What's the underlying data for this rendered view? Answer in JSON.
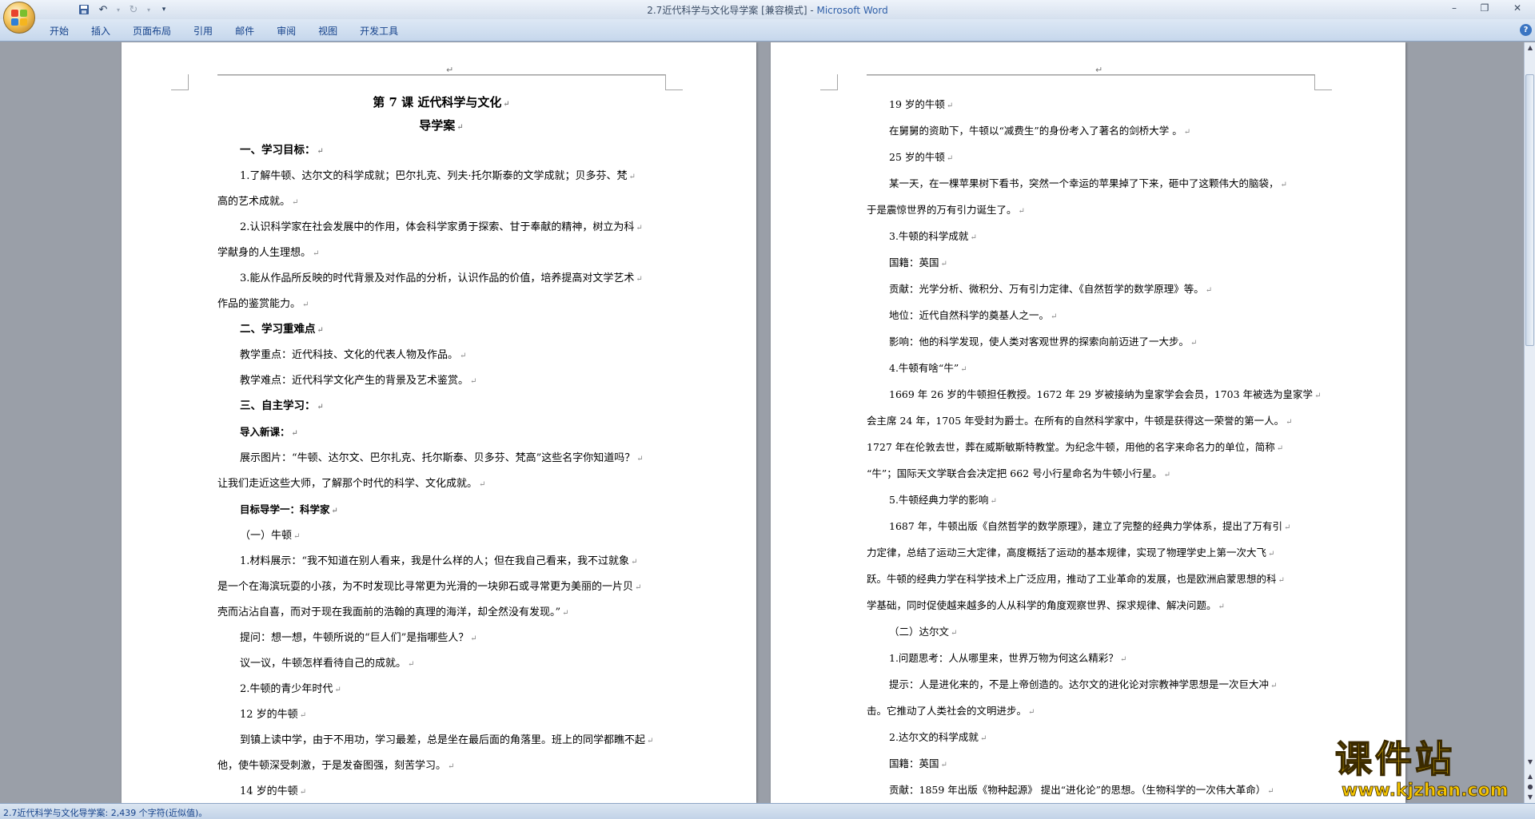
{
  "window": {
    "title": "2.7近代科学与文化导学案 [兼容模式]",
    "app_name": "Microsoft Word",
    "title_separator": " - "
  },
  "quick_access": {
    "icons": [
      "save-icon",
      "undo-icon",
      "redo-icon",
      "customize-icon"
    ]
  },
  "ribbon": {
    "tabs": [
      "开始",
      "插入",
      "页面布局",
      "引用",
      "邮件",
      "审阅",
      "视图",
      "开发工具"
    ]
  },
  "document": {
    "left_page": [
      {
        "text": "第 7 课  近代科学与文化",
        "style": "title"
      },
      {
        "text": "导学案",
        "style": "title"
      },
      {
        "text": "一、学习目标：",
        "style": "heading"
      },
      {
        "text": "1.了解牛顿、达尔文的科学成就；巴尔扎克、列夫·托尔斯泰的文学成就；贝多芬、梵",
        "style": "ind"
      },
      {
        "text": "高的艺术成就。",
        "style": "plain"
      },
      {
        "text": "2.认识科学家在社会发展中的作用，体会科学家勇于探索、甘于奉献的精神，树立为科",
        "style": "ind"
      },
      {
        "text": "学献身的人生理想。",
        "style": "plain"
      },
      {
        "text": "3.能从作品所反映的时代背景及对作品的分析，认识作品的价值，培养提高对文学艺术",
        "style": "ind"
      },
      {
        "text": "作品的鉴赏能力。",
        "style": "plain"
      },
      {
        "text": "二、学习重难点",
        "style": "heading"
      },
      {
        "text": "教学重点：近代科技、文化的代表人物及作品。",
        "style": "ind"
      },
      {
        "text": "教学难点：近代科学文化产生的背景及艺术鉴赏。",
        "style": "ind"
      },
      {
        "text": "三、自主学习：",
        "style": "heading"
      },
      {
        "text": "导入新课：",
        "style": "heading-small"
      },
      {
        "text": "展示图片：“牛顿、达尔文、巴尔扎克、托尔斯泰、贝多芬、梵高”这些名字你知道吗？",
        "style": "ind"
      },
      {
        "text": "让我们走近这些大师，了解那个时代的科学、文化成就。",
        "style": "plain"
      },
      {
        "text": "目标导学一：科学家",
        "style": "heading-small"
      },
      {
        "text": "（一）牛顿",
        "style": "ind"
      },
      {
        "text": "1.材料展示：“我不知道在别人看来，我是什么样的人；但在我自己看来，我不过就象",
        "style": "ind"
      },
      {
        "text": "是一个在海滨玩耍的小孩，为不时发现比寻常更为光滑的一块卵石或寻常更为美丽的一片贝",
        "style": "plain"
      },
      {
        "text": "壳而沾沾自喜，而对于现在我面前的浩翰的真理的海洋，却全然没有发现。”",
        "style": "plain"
      },
      {
        "text": "提问：想一想，牛顿所说的“巨人们”是指哪些人？",
        "style": "ind"
      },
      {
        "text": "议一议，牛顿怎样看待自己的成就。",
        "style": "ind"
      },
      {
        "text": "2.牛顿的青少年时代",
        "style": "ind"
      },
      {
        "text": "12 岁的牛顿",
        "style": "ind"
      },
      {
        "text": "到镇上读中学，由于不用功，学习最差，总是坐在最后面的角落里。班上的同学都瞧不起",
        "style": "ind"
      },
      {
        "text": "他，使牛顿深受刺激，于是发奋图强，刻苦学习。",
        "style": "plain"
      },
      {
        "text": "14 岁的牛顿",
        "style": "ind"
      }
    ],
    "right_page": [
      {
        "text": "19 岁的牛顿",
        "style": "ind"
      },
      {
        "text": "在舅舅的资助下，牛顿以“减费生”的身份考入了著名的剑桥大学   。",
        "style": "ind"
      },
      {
        "text": "25 岁的牛顿",
        "style": "ind"
      },
      {
        "text": "某一天，在一棵苹果树下看书，突然一个幸运的苹果掉了下来，砸中了这颗伟大的脑袋，",
        "style": "ind"
      },
      {
        "text": "于是震惊世界的万有引力诞生了。",
        "style": "plain"
      },
      {
        "text": "3.牛顿的科学成就",
        "style": "ind"
      },
      {
        "text": "国籍：英国",
        "style": "ind"
      },
      {
        "text": "贡献：光学分析、微积分、万有引力定律、《自然哲学的数学原理》等。",
        "style": "ind"
      },
      {
        "text": "地位：近代自然科学的奠基人之一。",
        "style": "ind"
      },
      {
        "text": "影响：他的科学发现，使人类对客观世界的探索向前迈进了一大步。",
        "style": "ind"
      },
      {
        "text": "4.牛顿有啥“牛”",
        "style": "ind"
      },
      {
        "text": "1669 年 26 岁的牛顿担任教授。1672 年 29 岁被接纳为皇家学会会员，1703 年被选为皇家学",
        "style": "ind"
      },
      {
        "text": "会主席 24 年，1705 年受封为爵士。在所有的自然科学家中，牛顿是获得这一荣誉的第一人。",
        "style": "plain"
      },
      {
        "text": "1727 年在伦敦去世，葬在威斯敏斯特教堂。为纪念牛顿，用他的名字来命名力的单位，简称",
        "style": "plain"
      },
      {
        "text": "“牛”；国际天文学联合会决定把 662 号小行星命名为牛顿小行星。",
        "style": "plain"
      },
      {
        "text": "5.牛顿经典力学的影响",
        "style": "ind"
      },
      {
        "text": "1687 年，牛顿出版《自然哲学的数学原理》，建立了完整的经典力学体系，提出了万有引",
        "style": "ind"
      },
      {
        "text": "力定律，总结了运动三大定律，高度概括了运动的基本规律，实现了物理学史上第一次大飞",
        "style": "plain"
      },
      {
        "text": "跃。牛顿的经典力学在科学技术上广泛应用，推动了工业革命的发展，也是欧洲启蒙思想的科",
        "style": "plain"
      },
      {
        "text": "学基础，同时促使越来越多的人从科学的角度观察世界、探求规律、解决问题。",
        "style": "plain"
      },
      {
        "text": "（二）达尔文",
        "style": "ind"
      },
      {
        "text": "1.问题思考：人从哪里来，世界万物为何这么精彩？",
        "style": "ind"
      },
      {
        "text": "提示：人是进化来的，不是上帝创造的。达尔文的进化论对宗教神学思想是一次巨大冲",
        "style": "ind"
      },
      {
        "text": "击。它推动了人类社会的文明进步。",
        "style": "plain"
      },
      {
        "text": "2.达尔文的科学成就",
        "style": "ind"
      },
      {
        "text": "国籍：英国",
        "style": "ind"
      },
      {
        "text": "贡献：1859 年出版《物种起源》 提出“进化论”的思想。（生物科学的一次伟大革命）",
        "style": "ind"
      },
      {
        "text": "",
        "style": "plain"
      }
    ]
  },
  "status_bar": {
    "text": "2.7近代科学与文化导学案: 2,439 个字符(近似值)。"
  },
  "watermark": {
    "title": "课件站",
    "url": "www.kjzhan.com"
  },
  "colors": {
    "ribbon_text": "#15428b",
    "workspace": "#9a9fa8",
    "watermark_fill": "#f4c400"
  }
}
